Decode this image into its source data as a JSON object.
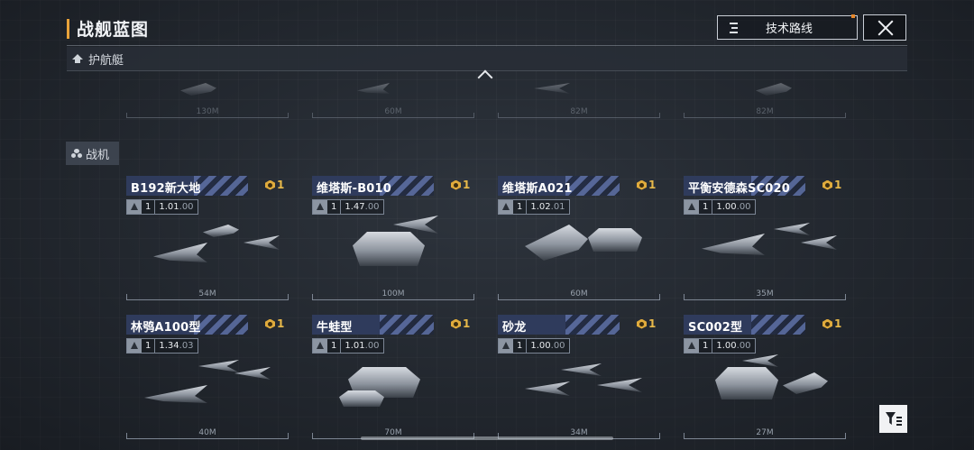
{
  "header": {
    "title": "战舰蓝图",
    "tech_route_label": "技术路线",
    "accent_color": "#e8a23a"
  },
  "sections": {
    "escort": {
      "label": "护航艇",
      "icon": "escort-ship-icon"
    },
    "fighter": {
      "label": "战机",
      "icon": "fighter-icon"
    }
  },
  "ghost_row": {
    "lengths": [
      "130M",
      "60M",
      "82M",
      "82M"
    ]
  },
  "cards": [
    {
      "name": "B192新大地",
      "count": "1",
      "level": "1",
      "version_main": "1.01",
      "version_sub": ".00",
      "length": "54M"
    },
    {
      "name": "维塔斯-B010",
      "count": "1",
      "level": "1",
      "version_main": "1.47",
      "version_sub": ".00",
      "length": "100M"
    },
    {
      "name": "维塔斯A021",
      "count": "1",
      "level": "1",
      "version_main": "1.02",
      "version_sub": ".01",
      "length": "60M"
    },
    {
      "name": "平衡安德森SC020",
      "count": "1",
      "level": "1",
      "version_main": "1.00",
      "version_sub": ".00",
      "length": "35M"
    },
    {
      "name": "林鸮A100型",
      "count": "1",
      "level": "1",
      "version_main": "1.34",
      "version_sub": ".03",
      "length": "40M"
    },
    {
      "name": "牛蛙型",
      "count": "1",
      "level": "1",
      "version_main": "1.01",
      "version_sub": ".00",
      "length": "70M"
    },
    {
      "name": "砂龙",
      "count": "1",
      "level": "1",
      "version_main": "1.00",
      "version_sub": ".00",
      "length": "34M"
    },
    {
      "name": "SC002型",
      "count": "1",
      "level": "1",
      "version_main": "1.00",
      "version_sub": ".00",
      "length": "27M"
    }
  ]
}
